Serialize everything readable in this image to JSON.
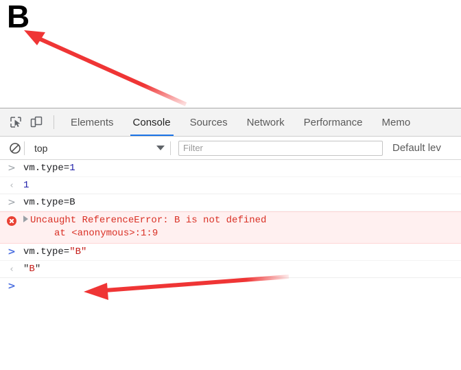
{
  "page": {
    "letter": "B"
  },
  "annotations": [
    {
      "name": "arrow-to-page-letter",
      "color": "#ef3535"
    },
    {
      "name": "arrow-to-string-output",
      "color": "#ef3535"
    }
  ],
  "devtools": {
    "toolbar": {
      "inspect_icon": "inspect-element-icon",
      "device_icon": "device-toolbar-icon"
    },
    "tabs": [
      {
        "label": "Elements",
        "active": false
      },
      {
        "label": "Console",
        "active": true
      },
      {
        "label": "Sources",
        "active": false
      },
      {
        "label": "Network",
        "active": false
      },
      {
        "label": "Performance",
        "active": false
      },
      {
        "label": "Memo",
        "active": false
      }
    ],
    "filterbar": {
      "clear_icon": "clear-console-icon",
      "context": "top",
      "caret_icon": "chevron-down-icon",
      "filter_value": "",
      "filter_placeholder": "Filter",
      "levels": "Default lev"
    },
    "console": {
      "rows": [
        {
          "kind": "input",
          "caret": ">",
          "caret_color": "gray",
          "tokens": [
            {
              "text": "vm.type=",
              "cls": "tok-plain"
            },
            {
              "text": "1",
              "cls": "tok-number"
            }
          ]
        },
        {
          "kind": "output",
          "caret": "‹",
          "caret_color": "resp",
          "tokens": [
            {
              "text": "1",
              "cls": "tok-number"
            }
          ]
        },
        {
          "kind": "input",
          "caret": ">",
          "caret_color": "gray",
          "tokens": [
            {
              "text": "vm.type=B",
              "cls": "tok-plain"
            }
          ]
        },
        {
          "kind": "error",
          "icon": "error-icon",
          "expander": "expand-triangle-icon",
          "message": "Uncaught ReferenceError: B is not defined",
          "stack": "at <anonymous>:1:9"
        },
        {
          "kind": "input",
          "caret": ">",
          "caret_color": "blue",
          "tokens": [
            {
              "text": "vm.type=",
              "cls": "tok-plain"
            },
            {
              "text": "\"B\"",
              "cls": "tok-string"
            }
          ]
        },
        {
          "kind": "output",
          "caret": "‹",
          "caret_color": "resp",
          "tokens": [
            {
              "text": "\"",
              "cls": "tok-quote"
            },
            {
              "text": "B",
              "cls": "tok-string"
            },
            {
              "text": "\"",
              "cls": "tok-quote"
            }
          ]
        }
      ],
      "prompt_caret": ">"
    }
  }
}
